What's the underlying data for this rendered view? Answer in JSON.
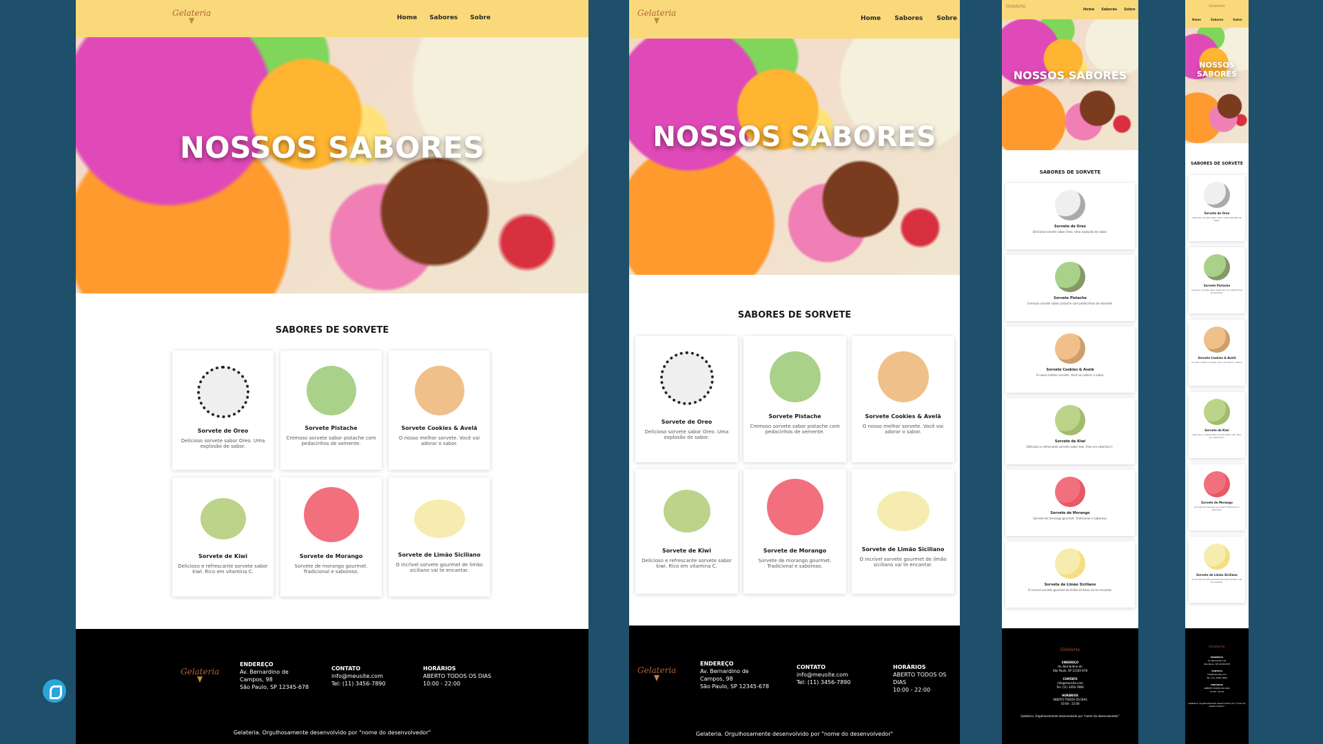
{
  "site": {
    "logo": "Gelateria",
    "nav": [
      "Home",
      "Sabores",
      "Sobre"
    ],
    "hero_title": "NOSSOS SABORES",
    "section_title": "SABORES DE SORVETE"
  },
  "flavors": [
    {
      "name": "Sorvete de Oreo",
      "desc": "Delicioso sorvete sabor Oreo. Uma explosão de sabor.",
      "color": "#efefef",
      "accent": "#222222"
    },
    {
      "name": "Sorvete Pistache",
      "desc": "Cremoso sorvete sabor pistache com pedacinhos de semente.",
      "color": "#a9d18a",
      "accent": "#3b2a1a"
    },
    {
      "name": "Sorvete Cookies & Avelã",
      "desc": "O nosso melhor sorvete. Você vai adorar o sabor.",
      "color": "#f0c08a",
      "accent": "#8a5a2e"
    },
    {
      "name": "Sorvete de Kiwi",
      "desc": "Delicioso e refrescante sorvete sabor kiwi. Rico em vitamina C.",
      "color": "#bcd38a",
      "accent": "#6d8f2a"
    },
    {
      "name": "Sorvete de Morango",
      "desc": "Sorvete de morango gourmet. Tradicional e saboroso.",
      "color": "#f26f7d",
      "accent": "#d42a35"
    },
    {
      "name": "Sorvete de Limão Siciliano",
      "desc": "O incrível sorvete gourmet de limão siciliano vai te encantar.",
      "color": "#f6ecb0",
      "accent": "#f2c21a"
    }
  ],
  "footer": {
    "address_title": "ENDEREÇO",
    "address_line1": "Av. Bernardino de",
    "address_line2": "Campos, 98",
    "address_line3": "São Paulo, SP 12345-678",
    "contact_title": "CONTATO",
    "contact_email": "info@meusite.com",
    "contact_phone": "Tel: (11) 3456-7890",
    "hours_title": "HORÁRIOS",
    "hours_line1": "ABERTO TODOS OS DIAS",
    "hours_line2": "10:00 - 22:00",
    "copyright": "Gelateria. Orgulhosamente desenvolvido por \"nome do desenvolvedor\""
  }
}
